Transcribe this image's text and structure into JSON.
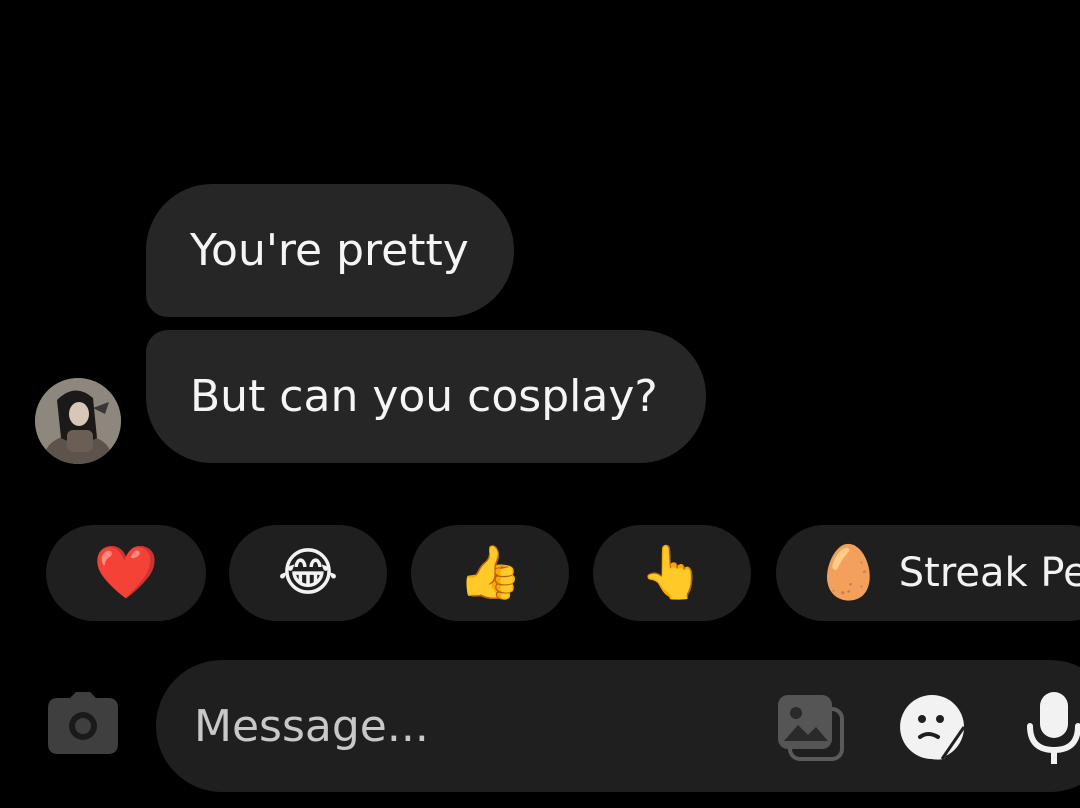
{
  "chat": {
    "messages": [
      {
        "text": "You're pretty"
      },
      {
        "text": "But can you cosplay?"
      }
    ]
  },
  "reactions": [
    {
      "emoji": "❤️",
      "icon": "heart-icon"
    },
    {
      "emoji": "😂",
      "icon": "laughing-face-icon"
    },
    {
      "emoji": "👍",
      "icon": "thumbs-up-icon"
    },
    {
      "emoji": "👆",
      "icon": "pointing-hand-icon"
    }
  ],
  "streak_pet": {
    "emoji": "🥚",
    "label": "Streak Pet",
    "icon": "egg-pet-icon"
  },
  "composer": {
    "placeholder": "Message...",
    "icons": [
      "camera-icon",
      "gallery-icon",
      "sticker-icon",
      "microphone-icon"
    ]
  },
  "colors": {
    "background": "#000000",
    "bubble": "#262626",
    "chip": "#1f1f1f",
    "text": "#f5f5f5"
  }
}
